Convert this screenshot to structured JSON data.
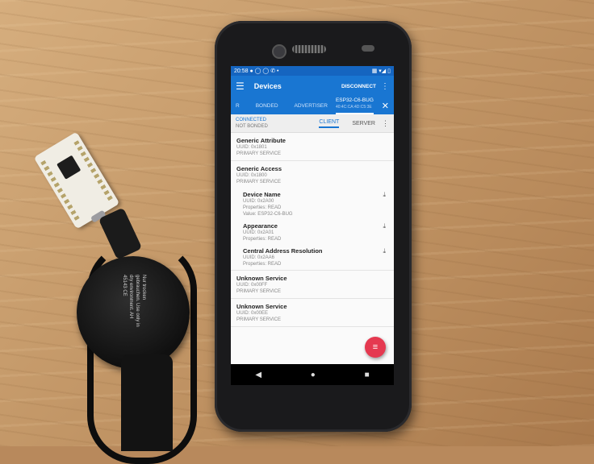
{
  "status_bar": {
    "time": "20:58",
    "icons": "● ◯ ◯ ✆ •",
    "right": "▦ ▾◢ ▯"
  },
  "app_bar": {
    "title": "Devices",
    "action": "DISCONNECT",
    "menu_icon": "hamburger-icon",
    "more_icon": "more-vert-icon"
  },
  "tabs": [
    {
      "label": "R"
    },
    {
      "label": "BONDED"
    },
    {
      "label": "ADVERTISER"
    }
  ],
  "active_tab": {
    "label": "ESP32-C6-BUG",
    "sub": "40:4C:CA:4D:C5:3E"
  },
  "connection": {
    "state": "CONNECTED",
    "bond": "NOT BONDED",
    "client_tab": "CLIENT",
    "server_tab": "SERVER"
  },
  "services": [
    {
      "name": "Generic Attribute",
      "uuid": "UUID: 0x1801",
      "type": "PRIMARY SERVICE"
    },
    {
      "name": "Generic Access",
      "uuid": "UUID: 0x1800",
      "type": "PRIMARY SERVICE"
    }
  ],
  "characteristics": [
    {
      "name": "Device Name",
      "uuid": "UUID: 0x2A00",
      "props": "Properties: READ",
      "value": "Value: ESP32-C6-BUG"
    },
    {
      "name": "Appearance",
      "uuid": "UUID: 0x2A01",
      "props": "Properties: READ"
    },
    {
      "name": "Central Address Resolution",
      "uuid": "UUID: 0x2AA6",
      "props": "Properties: READ"
    }
  ],
  "more_services": [
    {
      "name": "Unknown Service",
      "uuid": "UUID: 0x00FF",
      "type": "PRIMARY SERVICE"
    },
    {
      "name": "Unknown Service",
      "uuid": "UUID: 0x00EE",
      "type": "PRIMARY SERVICE"
    }
  ],
  "fab_icon": "list-icon",
  "nav": {
    "back": "◀",
    "home": "●",
    "recents": "■"
  },
  "reel_text": "Nur trocken gebrauchen. Use only in dry environment. AH 45143 CE"
}
